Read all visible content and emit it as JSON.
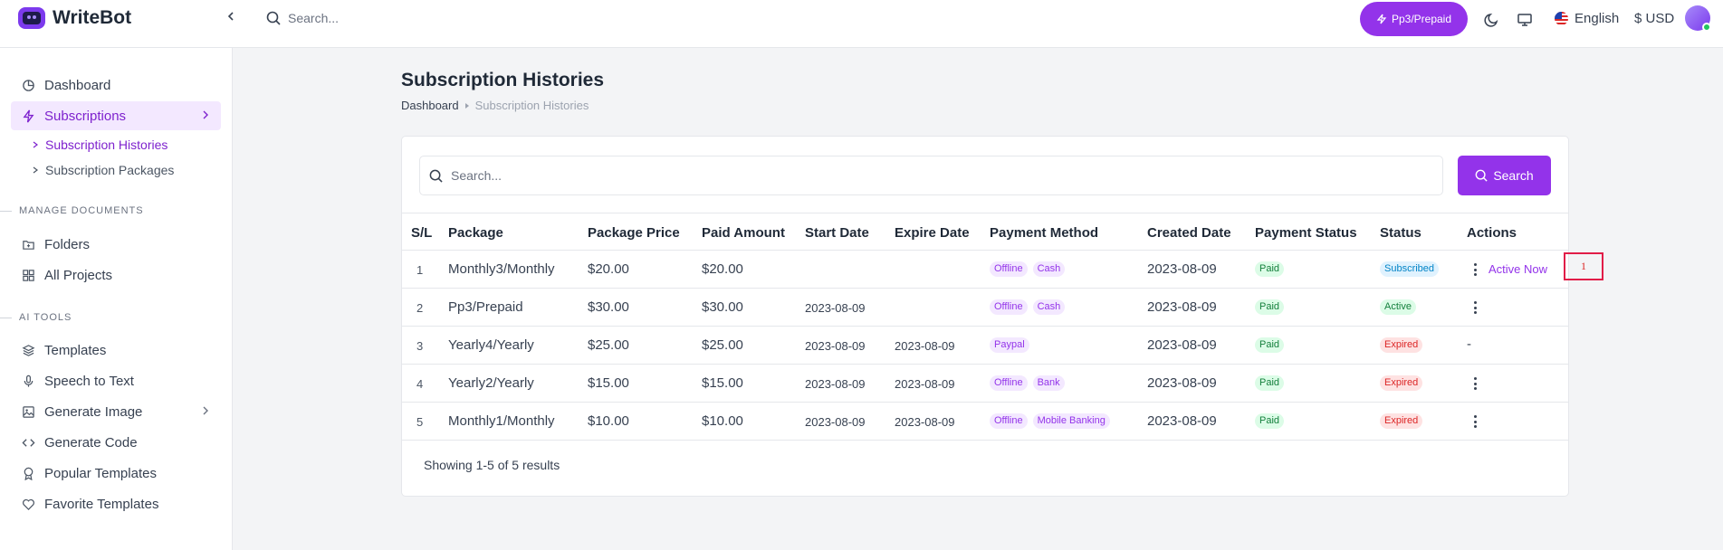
{
  "app": {
    "name": "WriteBot"
  },
  "topbar": {
    "search_placeholder": "Search...",
    "plan_label": "Pp3/Prepaid",
    "language": "English",
    "currency": "$ USD"
  },
  "sidebar": {
    "items": [
      {
        "label": "Dashboard",
        "icon": "chart-pie-icon"
      },
      {
        "label": "Subscriptions",
        "icon": "lightning-icon",
        "active": true
      },
      {
        "label": "Subscription Histories",
        "active": true
      },
      {
        "label": "Subscription Packages"
      }
    ],
    "sections": [
      {
        "label": "MANAGE DOCUMENTS",
        "items": [
          {
            "label": "Folders",
            "icon": "folder-icon"
          },
          {
            "label": "All Projects",
            "icon": "grid-icon"
          }
        ]
      },
      {
        "label": "AI TOOLS",
        "items": [
          {
            "label": "Templates",
            "icon": "layers-icon"
          },
          {
            "label": "Speech to Text",
            "icon": "microphone-icon"
          },
          {
            "label": "Generate Image",
            "icon": "image-icon"
          },
          {
            "label": "Generate Code",
            "icon": "code-icon"
          },
          {
            "label": "Popular Templates",
            "icon": "award-icon"
          },
          {
            "label": "Favorite Templates",
            "icon": "heart-icon"
          }
        ]
      }
    ]
  },
  "page": {
    "title": "Subscription Histories",
    "breadcrumb": [
      "Dashboard",
      "Subscription Histories"
    ],
    "search_placeholder": "Search...",
    "search_button": "Search"
  },
  "table": {
    "headers": [
      "S/L",
      "Package",
      "Package Price",
      "Paid Amount",
      "Start Date",
      "Expire Date",
      "Payment Method",
      "Created Date",
      "Payment Status",
      "Status",
      "Actions"
    ],
    "rows": [
      {
        "sl": "1",
        "package": "Monthly3/Monthly",
        "price": "$20.00",
        "paid": "$20.00",
        "start": "",
        "expire": "",
        "methods": [
          "Offline",
          "Cash"
        ],
        "created": "2023-08-09",
        "payment_status": "Paid",
        "status": "Subscribed",
        "status_color": "blue",
        "action": "Active Now"
      },
      {
        "sl": "2",
        "package": "Pp3/Prepaid",
        "price": "$30.00",
        "paid": "$30.00",
        "start": "2023-08-09",
        "expire": "",
        "methods": [
          "Offline",
          "Cash"
        ],
        "created": "2023-08-09",
        "payment_status": "Paid",
        "status": "Active",
        "status_color": "green",
        "action": ""
      },
      {
        "sl": "3",
        "package": "Yearly4/Yearly",
        "price": "$25.00",
        "paid": "$25.00",
        "start": "2023-08-09",
        "expire": "2023-08-09",
        "methods": [
          "Paypal"
        ],
        "created": "2023-08-09",
        "payment_status": "Paid",
        "status": "Expired",
        "status_color": "red",
        "action": "-"
      },
      {
        "sl": "4",
        "package": "Yearly2/Yearly",
        "price": "$15.00",
        "paid": "$15.00",
        "start": "2023-08-09",
        "expire": "2023-08-09",
        "methods": [
          "Offline",
          "Bank"
        ],
        "created": "2023-08-09",
        "payment_status": "Paid",
        "status": "Expired",
        "status_color": "red",
        "action": ""
      },
      {
        "sl": "5",
        "package": "Monthly1/Monthly",
        "price": "$10.00",
        "paid": "$10.00",
        "start": "2023-08-09",
        "expire": "2023-08-09",
        "methods": [
          "Offline",
          "Mobile Banking"
        ],
        "created": "2023-08-09",
        "payment_status": "Paid",
        "status": "Expired",
        "status_color": "red",
        "action": ""
      }
    ],
    "footer": "Showing 1-5 of 5 results"
  },
  "annotation": {
    "marker_label": "1"
  },
  "colors": {
    "accent": "#9333ea",
    "accent_light": "#f3e8ff"
  }
}
